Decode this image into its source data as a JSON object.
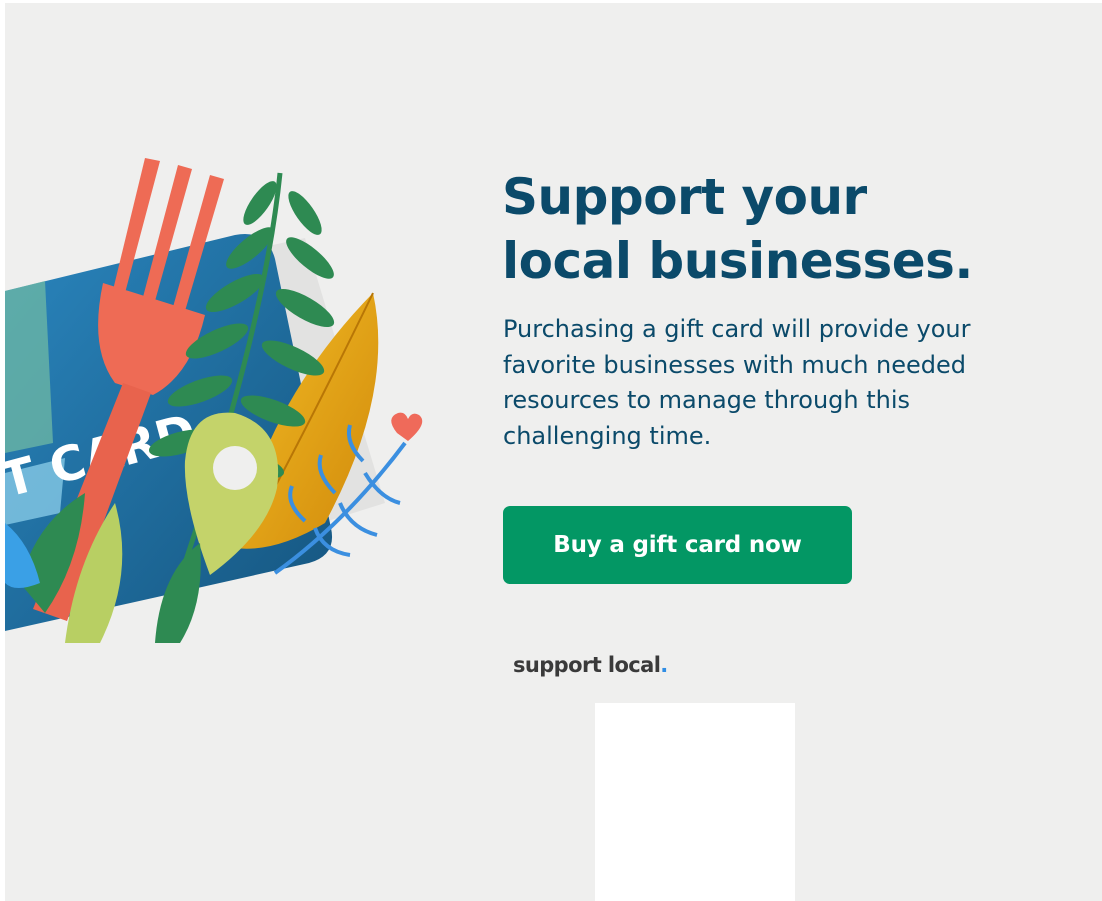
{
  "hero": {
    "headline_line1": "Support your",
    "headline_line2": "local businesses.",
    "body_line1": "Purchasing a gift card will provide your",
    "body_line2": "favorite businesses with much needed",
    "body_line3": "resources to manage through this",
    "body_line4": "challenging time.",
    "cta_label": "Buy a gift card now"
  },
  "illustration": {
    "card_text": "T CARD",
    "icons": [
      "gift-card",
      "fork-icon",
      "fern-leaf",
      "map-pin-icon",
      "heart-icon"
    ]
  },
  "logo": {
    "text": "support local",
    "dot": "."
  },
  "colors": {
    "background": "#efefee",
    "headline": "#0b4a6a",
    "cta_background": "#039764",
    "cta_text": "#ffffff",
    "logo_text": "#3a3a3a",
    "logo_dot": "#2f8de4",
    "card_blue": "#1f6fa6",
    "fork_coral": "#ee6b55",
    "leaf_green": "#2e8a52",
    "pin_lime": "#c4d36a",
    "leaf_gold": "#e6a814"
  }
}
